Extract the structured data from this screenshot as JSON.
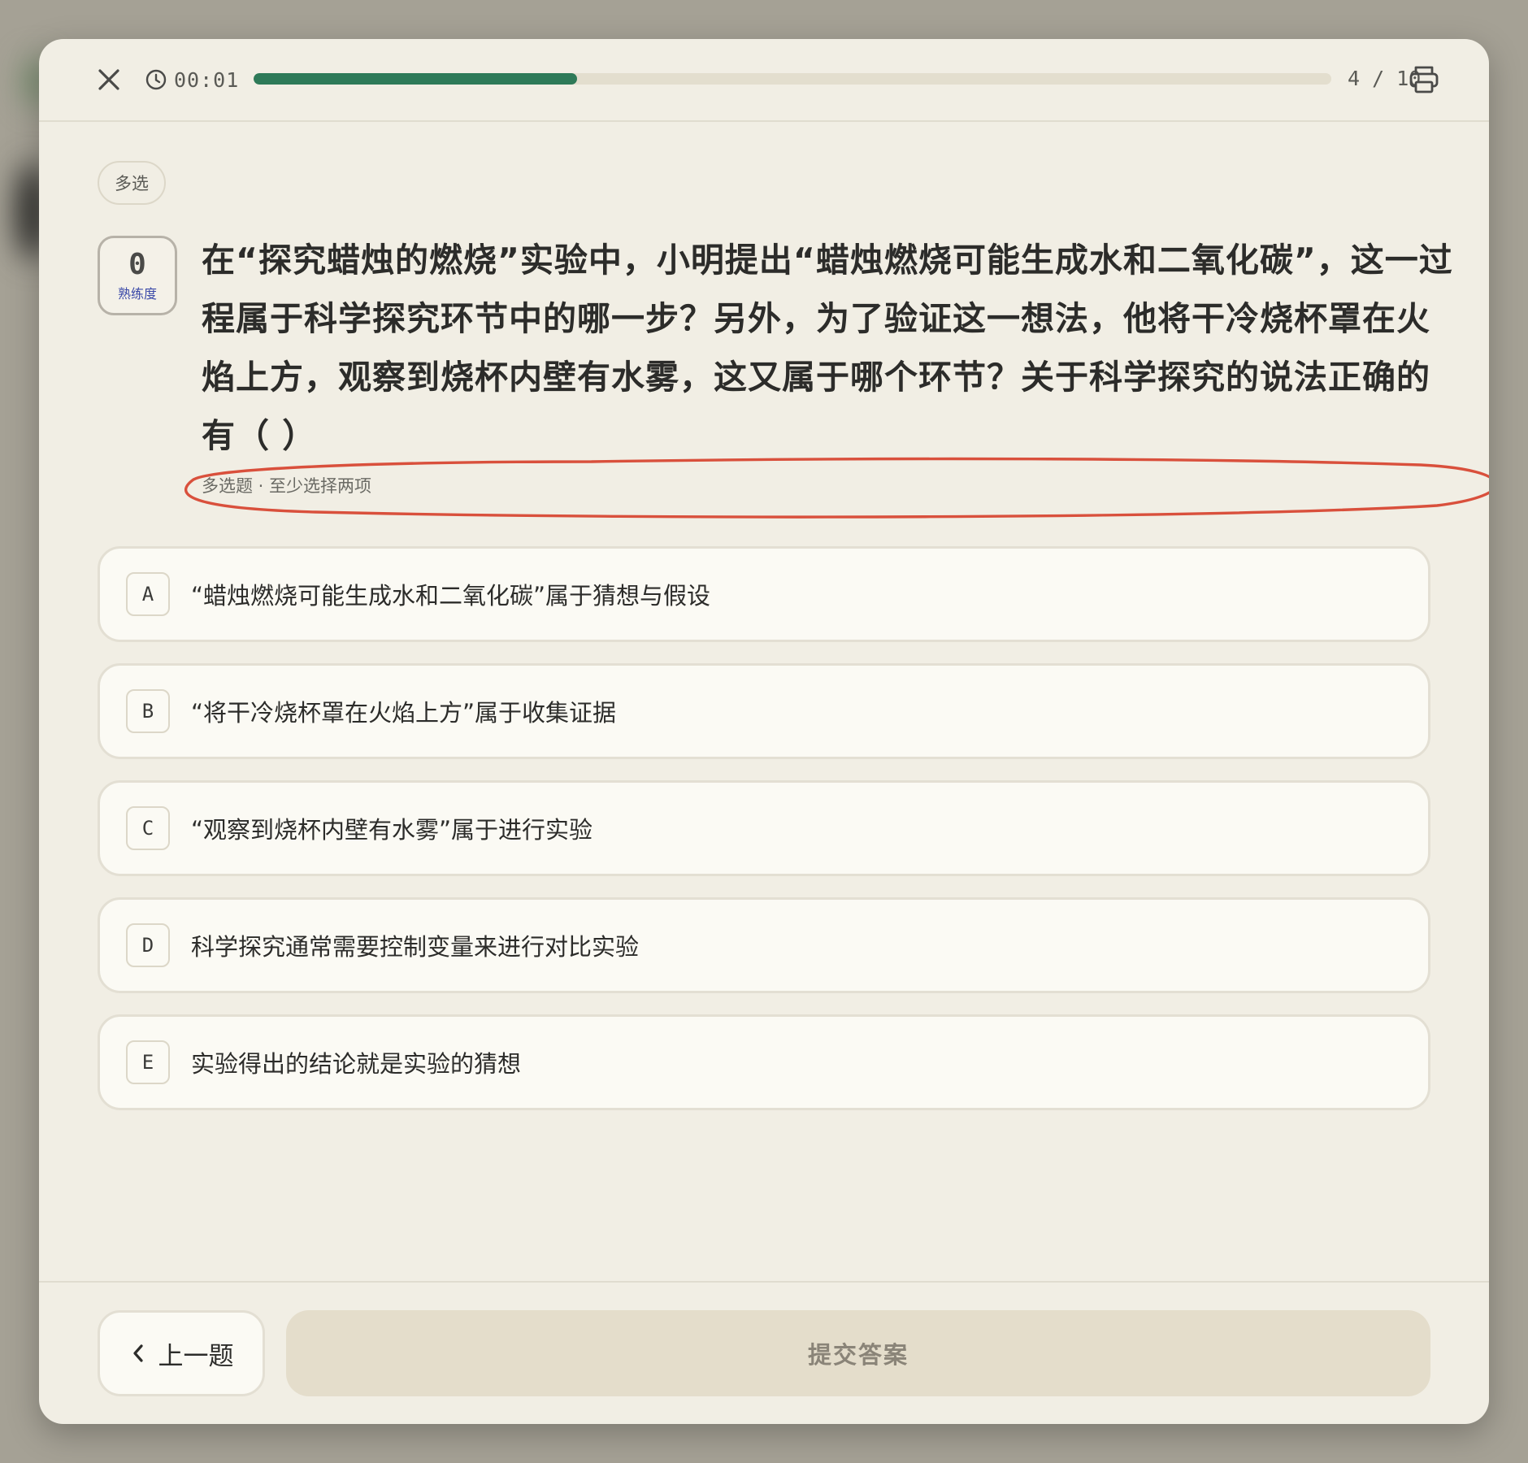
{
  "topbar": {
    "timer": "00:01",
    "progress": 0.3,
    "counter": "4 / 10",
    "accent_color": "#2e7a58",
    "icons": {
      "close": "close-icon",
      "clock": "clock-icon",
      "print": "printer-icon"
    }
  },
  "question": {
    "type_chip": "多选",
    "mastery_value": "0",
    "mastery_label": "熟练度",
    "text": "在“探究蜡烛的燃烧”实验中，小明提出“蜡烛燃烧可能生成水和二氧化碳”，这一过程属于科学探究环节中的哪一步？另外，为了验证这一想法，他将干冷烧杯罩在火焰上方，观察到烧杯内壁有水雾，这又属于哪个环节？关于科学探究的说法正确的有（  ）",
    "hint": "多选题 · 至少选择两项",
    "options": [
      {
        "key": "A",
        "text": "“蜡烛燃烧可能生成水和二氧化碳”属于猜想与假设"
      },
      {
        "key": "B",
        "text": "“将干冷烧杯罩在火焰上方”属于收集证据"
      },
      {
        "key": "C",
        "text": "“观察到烧杯内壁有水雾”属于进行实验"
      },
      {
        "key": "D",
        "text": "科学探究通常需要控制变量来进行对比实验"
      },
      {
        "key": "E",
        "text": "实验得出的结论就是实验的猜想"
      }
    ]
  },
  "footer": {
    "prev_label": "上一题",
    "submit_label": "提交答案"
  }
}
